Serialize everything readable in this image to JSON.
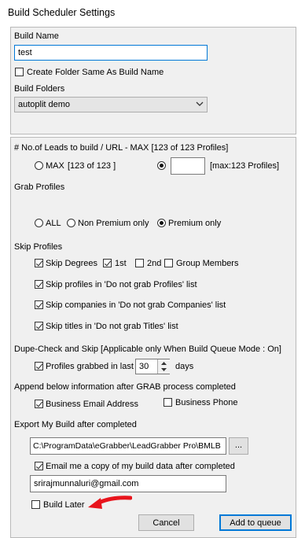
{
  "window": {
    "title": "Build Scheduler Settings"
  },
  "build_name": {
    "label": "Build Name",
    "value": "test"
  },
  "create_folder": {
    "label": "Create Folder Same As Build Name",
    "checked": false
  },
  "build_folders": {
    "label": "Build Folders",
    "selected": "autoplit demo"
  },
  "leads": {
    "label": "# No.of Leads to build / URL - MAX [123 of 123 Profiles]",
    "max_option": "MAX",
    "max_value": "[123 of 123 ]",
    "custom_value": "",
    "custom_hint": "[max:123 Profiles]"
  },
  "grab_profiles": {
    "label": "Grab Profiles",
    "options": [
      "ALL",
      "Non Premium only",
      "Premium only"
    ],
    "selected": "Premium only"
  },
  "skip_profiles": {
    "label": "Skip Profiles",
    "skip_degrees": "Skip Degrees",
    "first": "1st",
    "second": "2nd",
    "group_members": "Group Members",
    "not_grab_profiles": "Skip profiles in 'Do not grab Profiles' list",
    "not_grab_companies": "Skip companies in 'Do not grab Companies' list",
    "not_grab_titles": "Skip titles in 'Do not grab Titles' list"
  },
  "dupe_check": {
    "label": "Dupe-Check and Skip [Applicable only When Build Queue Mode  : On]",
    "grabbed_label": "Profiles grabbed in last",
    "days_value": "30",
    "days_unit": "days"
  },
  "append": {
    "label": "Append below information after GRAB process completed",
    "business_email": "Business Email Address",
    "business_phone": "Business Phone"
  },
  "export": {
    "label": "Export My Build after completed",
    "path": "C:\\ProgramData\\eGrabber\\LeadGrabber Pro\\BMLB",
    "browse": "...",
    "email_copy": "Email me a copy of my build data after completed",
    "email": "srirajmunnaluri@gmail.com"
  },
  "build_later": {
    "label": "Build Later",
    "checked": false
  },
  "buttons": {
    "cancel": "Cancel",
    "add": "Add to queue"
  },
  "colors": {
    "accent": "#0078d7",
    "arrow": "#e8141c"
  },
  "icons": {
    "dropdown": "chevron-down-icon",
    "spin_up": "arrow-up-icon",
    "spin_down": "arrow-down-icon",
    "annotation": "red-arrow-icon"
  }
}
